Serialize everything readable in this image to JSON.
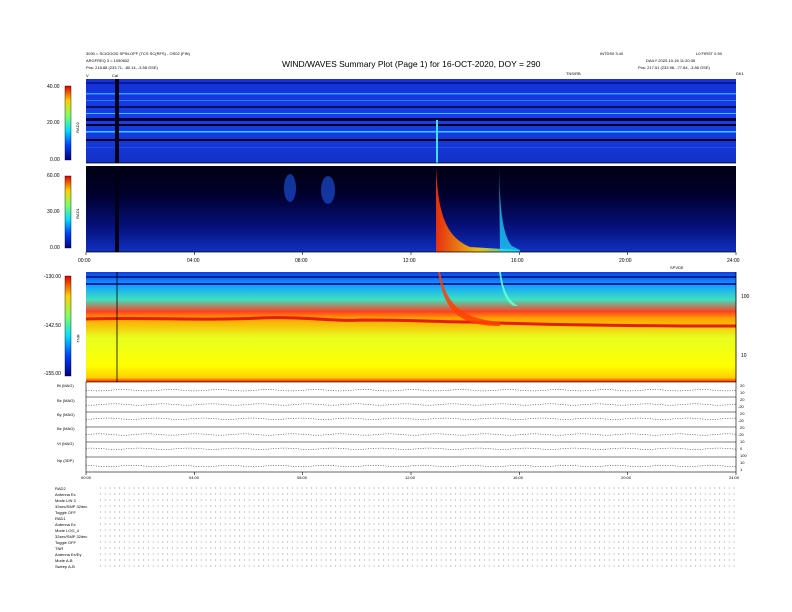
{
  "header": {
    "title": "WIND/WAVES Summary Plot (Page 1) for 16-OCT-2020, DOY = 290",
    "left_line1": "3030 = SCIGOOD SPIN-OFF (TCS SC(RFS) - OS02 (FIN)",
    "left_line2": "ARGFREQ 3 = 1050602",
    "left_line3": "Pos: 218.88 (233.71, -80.14, -3.58 GSE)",
    "right_small1": "INTDS0 3.40",
    "right_small2": "L0 FIRST 0.50",
    "right_line1": "DAILY 2020-10-16 11:20:35",
    "right_line2": "Pos: 217.51 (233.98, -77.84, -3.86 GSE)",
    "marker_v": "V",
    "marker_cal": "Cal",
    "marker_tn": "TNS/RB",
    "marker_end": "DK1"
  },
  "chart_data": [
    {
      "type": "heatmap",
      "name": "RAD2",
      "ylabel": "RAD2",
      "y_ticks": [
        "40.00",
        "20.00",
        "0.00"
      ],
      "ylim": [
        0,
        40
      ]
    },
    {
      "type": "heatmap",
      "name": "RAD1",
      "ylabel": "RAD1",
      "y_ticks": [
        "60.00",
        "30.00",
        "0.00"
      ],
      "ylim": [
        0,
        60
      ],
      "x_ticks": [
        "00:00",
        "04:00",
        "08:00",
        "12:00",
        "16:00",
        "20:00",
        "24:00"
      ]
    },
    {
      "type": "heatmap",
      "name": "TNR",
      "ylabel": "TNR",
      "y_ticks": [
        "-130.00",
        "-142.50",
        "-155.00"
      ],
      "ylim": [
        -155,
        -130
      ],
      "right_ticks": [
        "100",
        "10"
      ],
      "right_label": "SPVDE"
    },
    {
      "type": "line",
      "name": "key parameters",
      "rows": [
        {
          "label": "Bt (MAG)",
          "right": [
            "20",
            "10"
          ]
        },
        {
          "label": "Bx (MAG)",
          "right": [
            "20",
            "-20"
          ]
        },
        {
          "label": "By (MAG)",
          "right": [
            "20",
            "-20"
          ]
        },
        {
          "label": "Bz (MAG)",
          "right": [
            "20",
            "-20"
          ]
        },
        {
          "label": "Vt (MAG)",
          "right": [
            "10",
            "0"
          ]
        },
        {
          "label": "Np (3DP)",
          "right": [
            "100",
            "10",
            "1"
          ]
        }
      ],
      "x_ticks": [
        "00:00",
        "04:00",
        "08:00",
        "12:00",
        "16:00",
        "20:00",
        "24:00"
      ]
    }
  ],
  "footer": {
    "lines": [
      "RAD2",
      "Antenna        Ex",
      "Mode      LIN 3",
      "32sec/SMP 32dec",
      "Toggle       OFF",
      "RAD1",
      "Antenna        Ex",
      "Mode     LOG_4",
      "32sec/SMP 32dec",
      "Toggle       OFF",
      "TNR",
      "Antenna  Ex/Ey",
      "Mode         A-B",
      "Sweep         A-B"
    ]
  }
}
